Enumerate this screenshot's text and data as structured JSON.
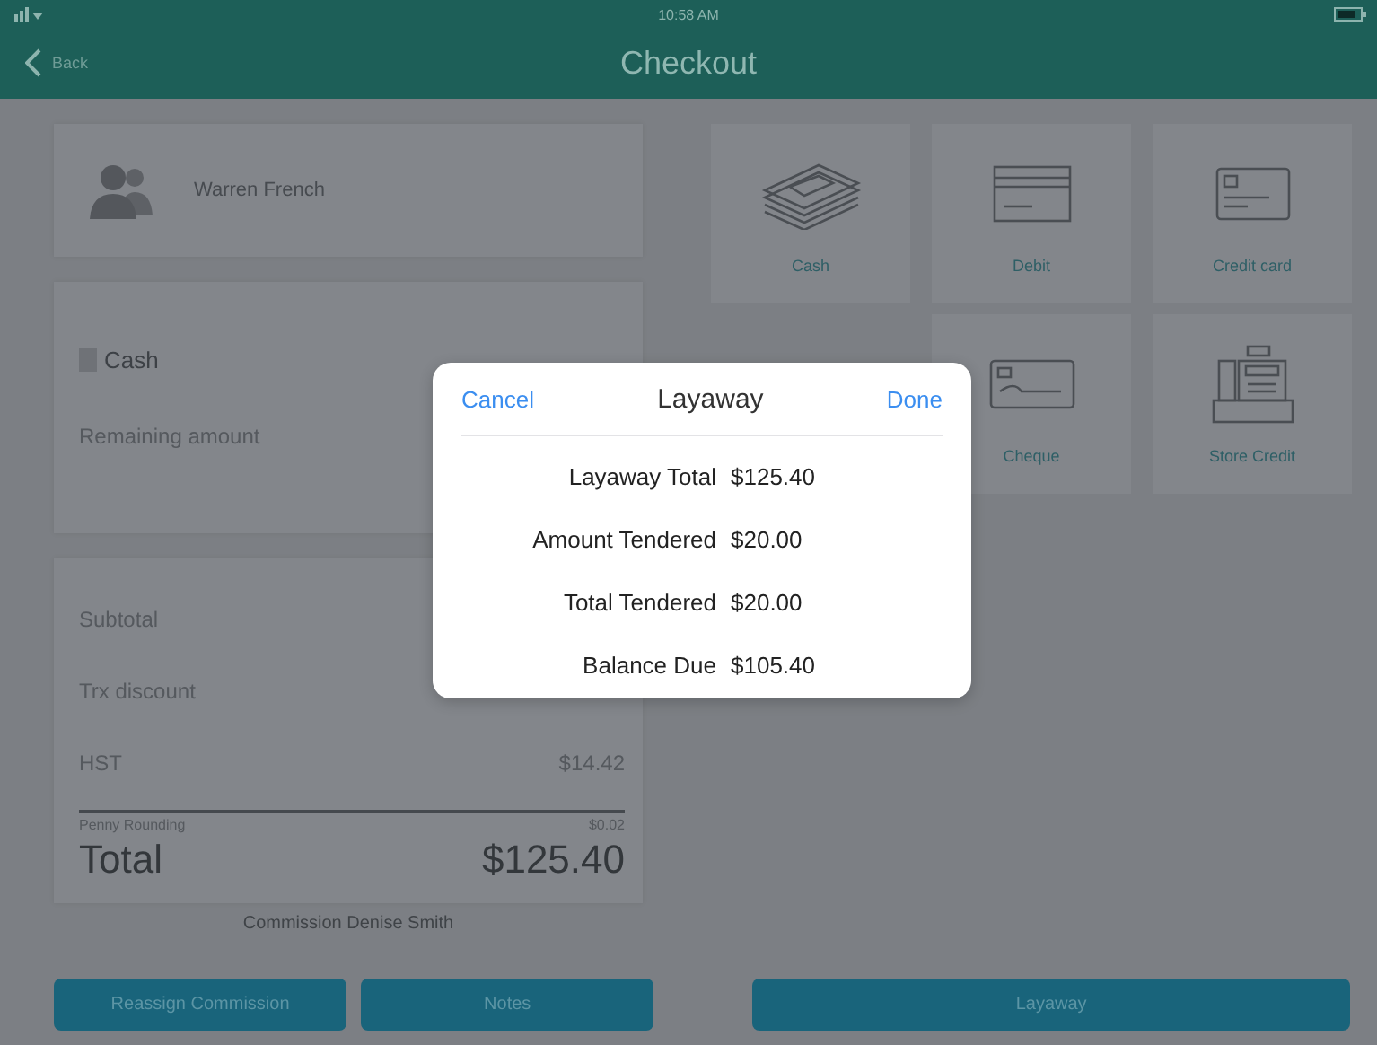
{
  "status_bar": {
    "time": "10:58 AM"
  },
  "nav": {
    "back": "Back",
    "title": "Checkout"
  },
  "customer": {
    "name": "Warren French"
  },
  "payment": {
    "method": "Cash",
    "remaining_label": "Remaining amount"
  },
  "totals": {
    "rows": [
      {
        "label": "Subtotal"
      },
      {
        "label": "Trx discount"
      },
      {
        "label": "HST",
        "value": "$14.42"
      }
    ],
    "rounding": {
      "label": "Penny Rounding",
      "value": "$0.02"
    },
    "total": {
      "label": "Total",
      "value": "$125.40"
    }
  },
  "commission": "Commission Denise Smith",
  "payment_methods": [
    [
      {
        "label": "Cash",
        "kind": "cash"
      },
      {
        "label": "Debit",
        "kind": "debit"
      },
      {
        "label": "Credit card",
        "kind": "credit"
      }
    ],
    [
      {
        "label": "Cheque",
        "kind": "cheque"
      },
      {
        "label": "Store Credit",
        "kind": "register"
      }
    ]
  ],
  "buttons": [
    "Reassign Commission",
    "Notes"
  ],
  "layaway_button": "Layaway",
  "dialog": {
    "cancel": "Cancel",
    "title": "Layaway",
    "done": "Done",
    "rows": [
      {
        "label": "Layaway Total",
        "value": "$125.40"
      },
      {
        "label": "Amount Tendered",
        "value": "$20.00"
      },
      {
        "label": "Total Tendered",
        "value": "$20.00"
      },
      {
        "label": "Balance Due",
        "value": "$105.40"
      }
    ]
  }
}
